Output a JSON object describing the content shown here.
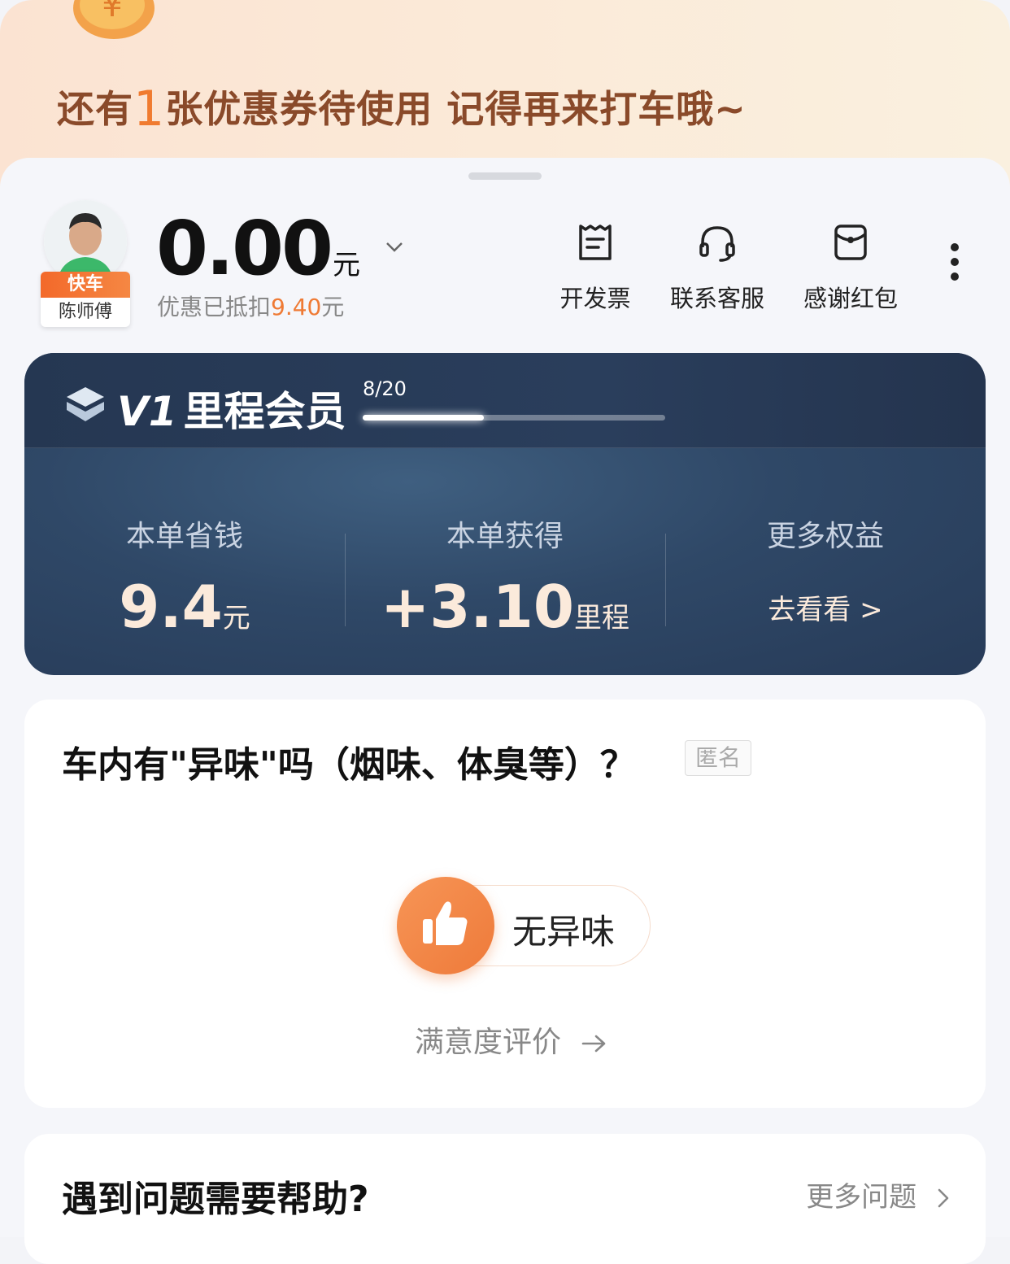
{
  "banner": {
    "text_before": "还有",
    "count": "1",
    "text_after": "张优惠券待使用 记得再来打车哦~"
  },
  "driver": {
    "brand": "快车",
    "name": "陈师傅"
  },
  "fare": {
    "amount": "0.00",
    "unit": "元",
    "discount_prefix": "优惠已抵扣",
    "discount_value": "9.40",
    "discount_unit": "元"
  },
  "actions": [
    {
      "label": "开发票",
      "icon": "invoice-icon"
    },
    {
      "label": "联系客服",
      "icon": "headset-icon"
    },
    {
      "label": "感谢红包",
      "icon": "red-envelope-icon"
    }
  ],
  "membership": {
    "level": "V1",
    "title": "里程会员",
    "progress_label": "8/20",
    "progress_fraction": 0.4,
    "stats": [
      {
        "label": "本单省钱",
        "value": "9.4",
        "unit": "元"
      },
      {
        "label": "本单获得",
        "value": "+3.10",
        "unit": "里程"
      },
      {
        "label": "更多权益",
        "link": "去看看 >"
      }
    ]
  },
  "feedback": {
    "question": "车内有\"异味\"吗（烟味、体臭等）？",
    "anonymous": "匿名",
    "answer": "无异味",
    "rate_link": "满意度评价"
  },
  "help": {
    "title": "遇到问题需要帮助?",
    "more": "更多问题"
  },
  "colors": {
    "accent": "#ef7a34",
    "member_bg": "#2f4867"
  }
}
